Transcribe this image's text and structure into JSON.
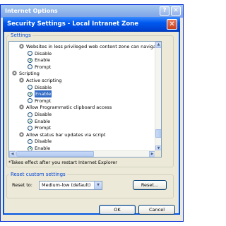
{
  "outer_window": {
    "title": "Internet Options",
    "help_glyph": "?",
    "close_glyph": "✕"
  },
  "dialog": {
    "title": "Security Settings - Local Intranet Zone",
    "close_glyph": "✕"
  },
  "settings": {
    "group_label": "Settings",
    "rows": [
      {
        "kind": "option",
        "label": "Websites in less privileged web content zone can navigate in",
        "indent": 2
      },
      {
        "kind": "radio",
        "label": "Disable",
        "selected": false,
        "indent": 3
      },
      {
        "kind": "radio",
        "label": "Enable",
        "selected": true,
        "indent": 3
      },
      {
        "kind": "radio",
        "label": "Prompt",
        "selected": false,
        "indent": 3
      },
      {
        "kind": "category",
        "label": "Scripting",
        "indent": 1
      },
      {
        "kind": "option",
        "label": "Active scripting",
        "indent": 2
      },
      {
        "kind": "radio",
        "label": "Disable",
        "selected": false,
        "indent": 3
      },
      {
        "kind": "radio",
        "label": "Enable",
        "selected": true,
        "highlighted": true,
        "indent": 3
      },
      {
        "kind": "radio",
        "label": "Prompt",
        "selected": false,
        "indent": 3
      },
      {
        "kind": "option",
        "label": "Allow Programmatic clipboard access",
        "indent": 2
      },
      {
        "kind": "radio",
        "label": "Disable",
        "selected": false,
        "indent": 3
      },
      {
        "kind": "radio",
        "label": "Enable",
        "selected": true,
        "indent": 3
      },
      {
        "kind": "radio",
        "label": "Prompt",
        "selected": false,
        "indent": 3
      },
      {
        "kind": "option",
        "label": "Allow status bar updates via script",
        "indent": 2
      },
      {
        "kind": "radio",
        "label": "Disable",
        "selected": false,
        "indent": 3
      },
      {
        "kind": "radio",
        "label": "Enable",
        "selected": true,
        "indent": 3
      }
    ],
    "scroll_position_fraction": 0.85
  },
  "restart_note": "*Takes effect after you restart Internet Explorer",
  "reset": {
    "group_label": "Reset custom settings",
    "reset_to_label": "Reset to:",
    "selected_level": "Medium-low (default)",
    "reset_button": "Reset..."
  },
  "buttons": {
    "ok": "OK",
    "cancel": "Cancel"
  }
}
